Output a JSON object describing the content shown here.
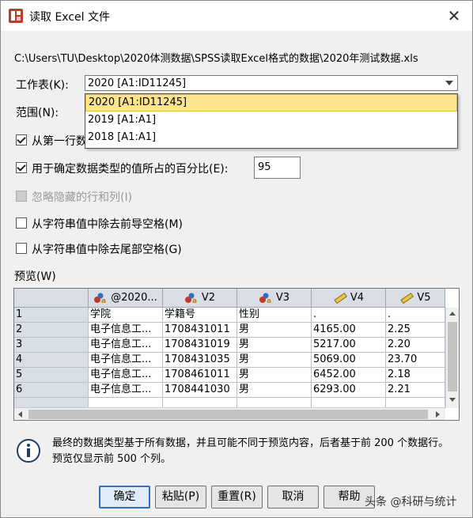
{
  "window": {
    "title": "读取 Excel 文件",
    "close_symbol": "✕"
  },
  "file_path": "C:\\Users\\TU\\Desktop\\2020体测数据\\SPSS读取Excel格式的数据\\2020年测试数据.xls",
  "worksheet": {
    "label": "工作表(K):",
    "selected": "2020 [A1:ID11245]",
    "options": [
      "2020 [A1:ID11245]",
      "2019 [A1:A1]",
      "2018 [A1:A1]"
    ]
  },
  "range": {
    "label": "范围(N):"
  },
  "options": {
    "first_row": "从第一行数",
    "percent": "用于确定数据类型的值所占的百分比(E):",
    "percent_value": "95",
    "ignore_hidden": "忽略隐藏的行和列(I)",
    "trim_leading": "从字符串值中除去前导空格(M)",
    "trim_trailing": "从字符串值中除去尾部空格(G)"
  },
  "preview": {
    "label": "预览(W)",
    "columns": [
      "@2020...",
      "V2",
      "V3",
      "V4",
      "V5"
    ],
    "rows": [
      [
        "1",
        "学院",
        "学籍号",
        "性别",
        ".",
        "."
      ],
      [
        "2",
        "电子信息工...",
        "1708431011",
        "男",
        "4165.00",
        "2.25"
      ],
      [
        "3",
        "电子信息工...",
        "1708431019",
        "男",
        "5217.00",
        "2.20"
      ],
      [
        "4",
        "电子信息工...",
        "1708431035",
        "男",
        "5069.00",
        "23.70"
      ],
      [
        "5",
        "电子信息工...",
        "1708461011",
        "男",
        "6452.00",
        "2.18"
      ],
      [
        "6",
        "电子信息工...",
        "1708441030",
        "男",
        "6293.00",
        "2.21"
      ]
    ]
  },
  "info": "最终的数据类型基于所有数据，并且可能不同于预览内容，后者基于前 200 个数据行。预览仅显示前 500 个列。",
  "buttons": {
    "ok": "确定",
    "paste": "粘贴(P)",
    "reset": "重置(R)",
    "cancel": "取消",
    "help": "帮助"
  },
  "watermark": "头条 @科研与统计",
  "colors": {
    "dropdown_selected": "#fbe38f",
    "grid_header": "#d8dde6",
    "default_button_border": "#2f6fc5"
  }
}
